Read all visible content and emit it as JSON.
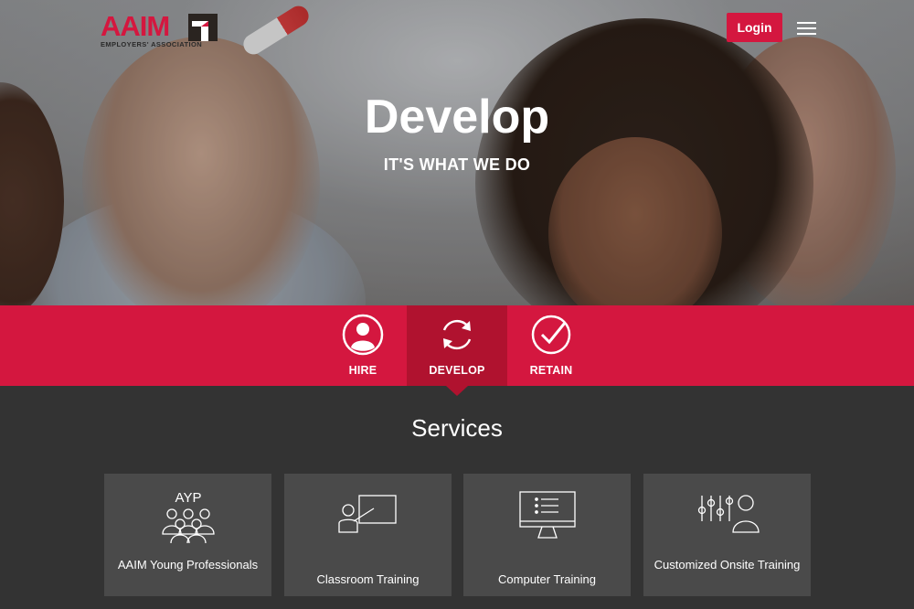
{
  "header": {
    "logo_text": "AAIM",
    "logo_tagline": "EMPLOYERS' ASSOCIATION",
    "login_label": "Login",
    "menu_icon": "hamburger-icon"
  },
  "hero": {
    "title": "Develop",
    "subtitle": "IT'S WHAT WE DO"
  },
  "tabs": [
    {
      "label": "HIRE",
      "icon": "person-icon",
      "active": false
    },
    {
      "label": "DEVELOP",
      "icon": "refresh-cycle-icon",
      "active": true
    },
    {
      "label": "RETAIN",
      "icon": "check-circle-icon",
      "active": false
    }
  ],
  "services": {
    "title": "Services",
    "cards": [
      {
        "label": "AAIM Young Professionals",
        "icon": "ayp-group-icon",
        "icon_text": "AYP"
      },
      {
        "label": "Classroom Training",
        "icon": "classroom-presenter-icon"
      },
      {
        "label": "Computer Training",
        "icon": "computer-monitor-icon"
      },
      {
        "label": "Customized Onsite Training",
        "icon": "sliders-person-icon"
      }
    ]
  },
  "colors": {
    "brand_red": "#d4173f",
    "active_tab": "#b0122f",
    "dark_bg": "#333333",
    "card_bg": "#4a4a4a"
  }
}
